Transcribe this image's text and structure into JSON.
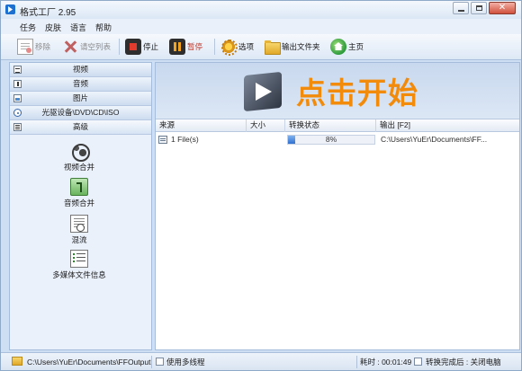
{
  "window": {
    "title": "格式工厂 2.95",
    "minimize": "minimize",
    "maximize": "maximize",
    "close": "✕"
  },
  "menu": [
    "任务",
    "皮肤",
    "语言",
    "帮助"
  ],
  "toolbar": {
    "remove": "移除",
    "clear_list": "请空列表",
    "stop": "停止",
    "pause": "暂停",
    "options": "选项",
    "output_folder": "输出文件夹",
    "home": "主页"
  },
  "sidebar": {
    "categories": [
      "视频",
      "音频",
      "图片",
      "光驱设备\\DVD\\CD\\ISO",
      "高级"
    ],
    "tools": [
      "视频合并",
      "音频合并",
      "混流",
      "多媒体文件信息"
    ]
  },
  "main": {
    "start_label": "点击开始",
    "columns": {
      "source": "来源",
      "size": "大小",
      "status": "转换状态",
      "output": "输出 [F2]"
    },
    "rows": [
      {
        "source": "1 File(s)",
        "size": "",
        "progress": 8,
        "progress_text": "8%",
        "output": "C:\\Users\\YuEr\\Documents\\FF..."
      }
    ]
  },
  "statusbar": {
    "output_path": "C:\\Users\\YuEr\\Documents\\FFOutput",
    "multithread_label": "使用多线程",
    "elapsed": "耗时 : 00:01:49",
    "after_done": "转换完成后 : 关闭电脑"
  },
  "colors": {
    "accent": "#f28b0c",
    "progress": "#2f6fd0",
    "panel": "#cfdff3"
  }
}
